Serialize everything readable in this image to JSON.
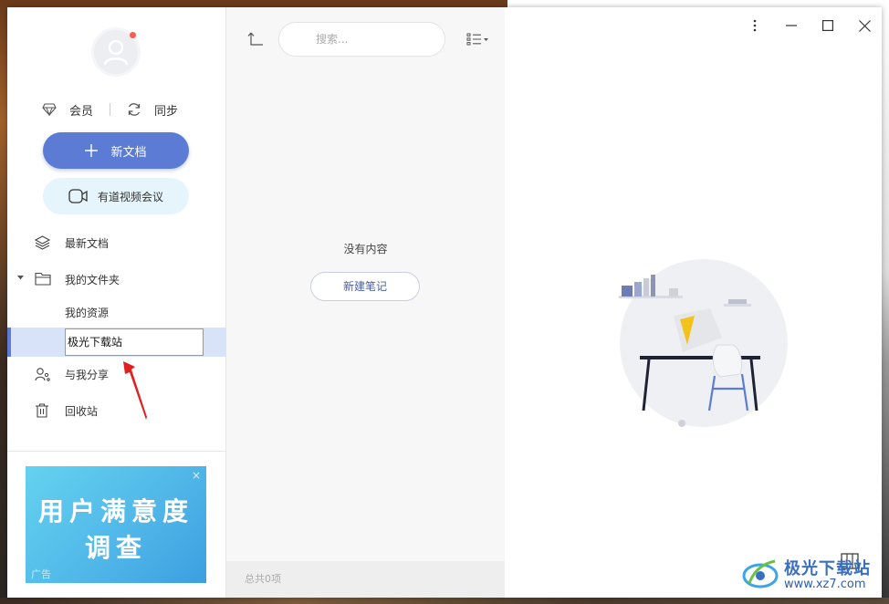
{
  "sidebar": {
    "account": {
      "vip_label": "会员",
      "sync_label": "同步"
    },
    "new_doc_label": "新文档",
    "meeting_label": "有道视频会议",
    "nav": {
      "recent": "最新文档",
      "my_folders": "我的文件夹",
      "my_resources": "我的资源",
      "renaming_folder_value": "极光下载站",
      "shared": "与我分享",
      "trash": "回收站"
    },
    "ad": {
      "line1": "用户满意度",
      "line2": "调查",
      "tag": "广告",
      "close": "×"
    }
  },
  "list": {
    "search_placeholder": "搜索...",
    "empty_text": "没有内容",
    "new_note_label": "新建笔记",
    "footer_count": "总共0项"
  },
  "content": {
    "watermark": {
      "title": "极光下载站",
      "url": "www.xz7.com"
    }
  },
  "colors": {
    "accent": "#5b7bd5",
    "meeting_bg": "#e6f4fb",
    "selected_row": "#d8e3fa",
    "notification_dot": "#ff5a4f",
    "annotation_arrow": "#e02020"
  }
}
